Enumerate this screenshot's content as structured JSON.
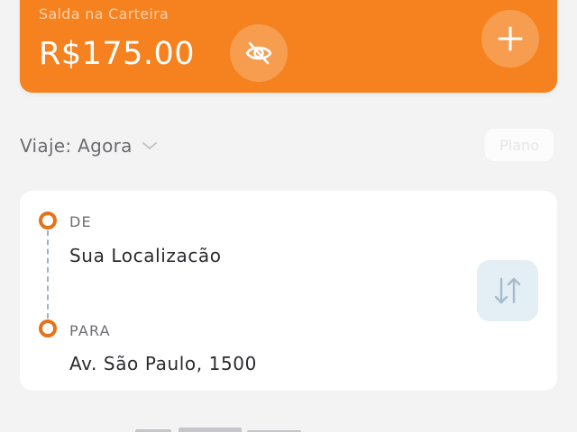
{
  "wallet": {
    "label": "Salda na Carteira",
    "amount": "R$175.00",
    "toggle_icon": "eye-off-icon",
    "add_icon": "plus-icon",
    "accent_color": "#f5821f"
  },
  "trip": {
    "time_label": "Viaje: Agora",
    "chevron_icon": "chevron-down-icon",
    "ghost_button_label": "Plano"
  },
  "route": {
    "from_label": "DE",
    "from_value": "Sua Localizacão",
    "to_label": "PARA",
    "to_value": "Av. São Paulo, 1500",
    "swap_icon": "swap-vertical-icon",
    "dot_color": "#e67318"
  }
}
